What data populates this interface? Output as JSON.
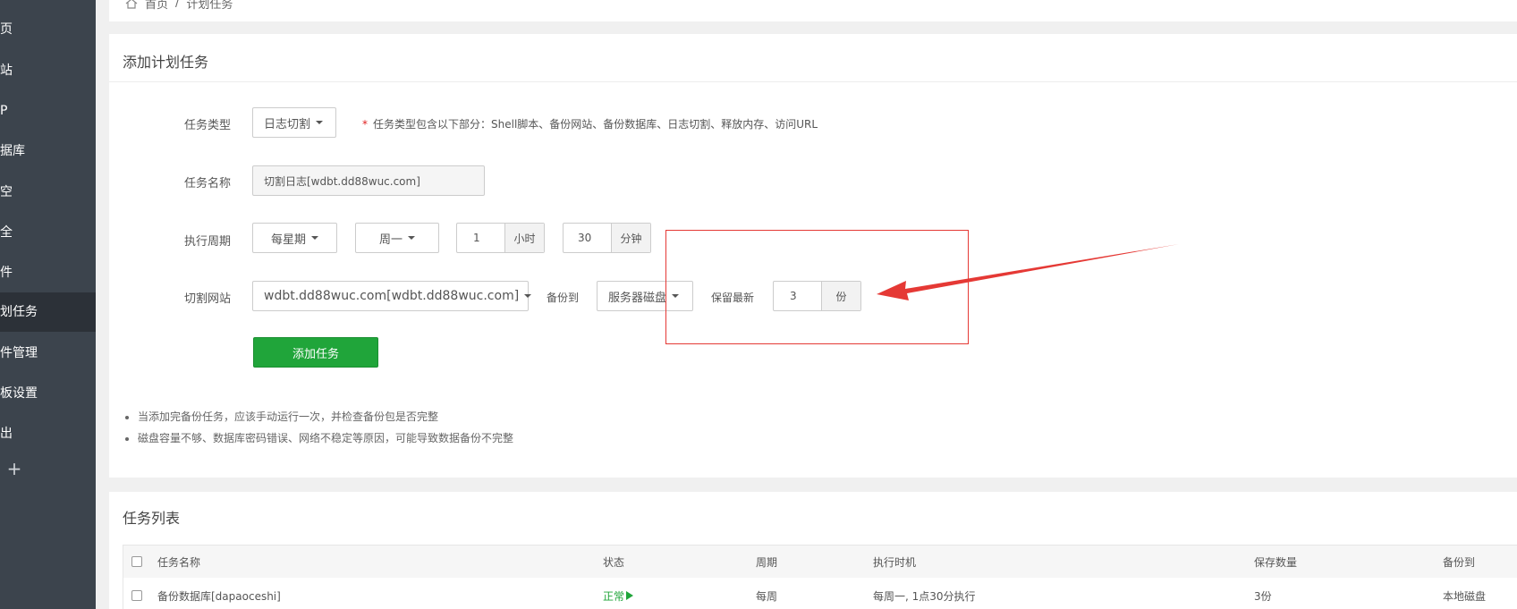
{
  "sidebar": {
    "items": [
      {
        "label": "页"
      },
      {
        "label": "站"
      },
      {
        "label": "P"
      },
      {
        "label": "据库"
      },
      {
        "label": "空"
      },
      {
        "label": "全"
      },
      {
        "label": "件"
      },
      {
        "label": "划任务",
        "active": true
      },
      {
        "label": "件管理"
      },
      {
        "label": "板设置"
      },
      {
        "label": "出"
      }
    ],
    "plus": "+"
  },
  "breadcrumb": {
    "home": "首页",
    "sep": "/",
    "current": "计划任务"
  },
  "add_panel": {
    "title": "添加计划任务",
    "task_type": {
      "label": "任务类型",
      "value": "日志切割",
      "note": "任务类型包含以下部分：Shell脚本、备份网站、备份数据库、日志切割、释放内存、访问URL"
    },
    "task_name": {
      "label": "任务名称",
      "value": "切割日志[wdbt.dd88wuc.com]"
    },
    "period": {
      "label": "执行周期",
      "type": "每星期",
      "weekday": "周一",
      "hour": "1",
      "hour_unit": "小时",
      "minute": "30",
      "minute_unit": "分钟"
    },
    "site": {
      "label": "切割网站",
      "value": "wdbt.dd88wuc.com[wdbt.dd88wuc.com]",
      "backup_label": "备份到",
      "backup_value": "服务器磁盘",
      "keep_label": "保留最新",
      "keep_value": "3",
      "keep_unit": "份"
    },
    "submit": "添加任务",
    "tips": [
      "当添加完备份任务，应该手动运行一次，并检查备份包是否完整",
      "磁盘容量不够、数据库密码错误、网络不稳定等原因，可能导致数据备份不完整"
    ]
  },
  "list_panel": {
    "title": "任务列表",
    "columns": [
      "任务名称",
      "状态",
      "周期",
      "执行时机",
      "保存数量",
      "备份到"
    ],
    "rows": [
      {
        "name": "备份数据库[dapaoceshi]",
        "status": "正常",
        "period": "每周",
        "timing": "每周一, 1点30分执行",
        "keep": "3份",
        "target": "本地磁盘"
      }
    ]
  },
  "colors": {
    "sidebar": "#3c444d",
    "sidebar_active": "#2c3138",
    "accent": "#20a53a",
    "annotation": "#e53935"
  }
}
